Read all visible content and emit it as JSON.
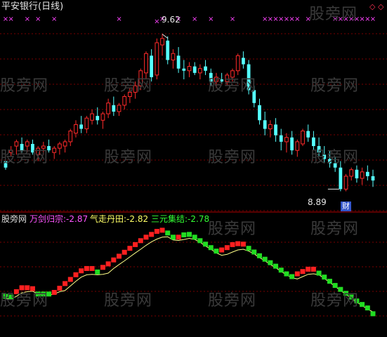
{
  "colors": {
    "background": "#000000",
    "up": "#ff2a2a",
    "down": "#55ffff",
    "grid": "#7a0000",
    "marker": "#ff44ff",
    "red_block": "#ff2020",
    "green_block": "#22dd22",
    "signal_line": "#ffff88",
    "title": "#e6e6e6",
    "indicator_name": "#dddddd",
    "wanjian": "#ff55ff",
    "qizou": "#ffff66",
    "sanyuan": "#33ff33",
    "watermark": "#3a3a3a"
  },
  "main_panel": {
    "title": "平安银行(日线)",
    "high_annotation": "9.62",
    "low_annotation": "8.89",
    "finance_badge": "财",
    "diamond_icons": [
      "diamond-outline-icon",
      "diamond-outline-icon"
    ]
  },
  "indicator_panel": {
    "name": "股旁网",
    "values": [
      {
        "label": "万剑归宗:",
        "value": "-2.87"
      },
      {
        "label": "气走丹田:",
        "value": "-2.82"
      },
      {
        "label": "三元集结:",
        "value": "-2.78"
      }
    ]
  },
  "watermark_text": "股旁网",
  "chart_data": {
    "type": "candlestick",
    "price_range": [
      8.8,
      9.72
    ],
    "candles": [
      [
        9.03,
        9.05,
        8.99,
        9.0
      ],
      [
        9.07,
        9.1,
        9.05,
        9.08
      ],
      [
        9.1,
        9.13,
        9.06,
        9.12
      ],
      [
        9.11,
        9.14,
        9.07,
        9.08
      ],
      [
        9.1,
        9.13,
        9.07,
        9.12
      ],
      [
        9.11,
        9.13,
        9.06,
        9.07
      ],
      [
        9.06,
        9.1,
        9.03,
        9.09
      ],
      [
        9.09,
        9.12,
        9.06,
        9.1
      ],
      [
        9.1,
        9.13,
        9.07,
        9.08
      ],
      [
        9.07,
        9.1,
        9.04,
        9.09
      ],
      [
        9.09,
        9.12,
        9.06,
        9.11
      ],
      [
        9.1,
        9.13,
        9.07,
        9.12
      ],
      [
        9.12,
        9.18,
        9.1,
        9.17
      ],
      [
        9.16,
        9.22,
        9.14,
        9.2
      ],
      [
        9.2,
        9.24,
        9.16,
        9.18
      ],
      [
        9.18,
        9.24,
        9.16,
        9.23
      ],
      [
        9.22,
        9.27,
        9.2,
        9.25
      ],
      [
        9.24,
        9.28,
        9.2,
        9.22
      ],
      [
        9.22,
        9.26,
        9.18,
        9.25
      ],
      [
        9.25,
        9.32,
        9.23,
        9.3
      ],
      [
        9.29,
        9.33,
        9.24,
        9.26
      ],
      [
        9.26,
        9.3,
        9.24,
        9.29
      ],
      [
        9.29,
        9.34,
        9.27,
        9.33
      ],
      [
        9.33,
        9.37,
        9.3,
        9.35
      ],
      [
        9.35,
        9.4,
        9.32,
        9.38
      ],
      [
        9.38,
        9.46,
        9.36,
        9.45
      ],
      [
        9.44,
        9.54,
        9.41,
        9.53
      ],
      [
        9.52,
        9.55,
        9.4,
        9.42
      ],
      [
        9.43,
        9.6,
        9.41,
        9.58
      ],
      [
        9.57,
        9.62,
        9.52,
        9.6
      ],
      [
        9.59,
        9.61,
        9.48,
        9.5
      ],
      [
        9.5,
        9.55,
        9.46,
        9.53
      ],
      [
        9.52,
        9.56,
        9.44,
        9.46
      ],
      [
        9.46,
        9.5,
        9.41,
        9.45
      ],
      [
        9.45,
        9.49,
        9.42,
        9.47
      ],
      [
        9.47,
        9.49,
        9.43,
        9.44
      ],
      [
        9.44,
        9.48,
        9.41,
        9.46
      ],
      [
        9.47,
        9.5,
        9.43,
        9.45
      ],
      [
        9.44,
        9.46,
        9.38,
        9.4
      ],
      [
        9.4,
        9.44,
        9.37,
        9.42
      ],
      [
        9.41,
        9.44,
        9.39,
        9.4
      ],
      [
        9.4,
        9.44,
        9.38,
        9.43
      ],
      [
        9.42,
        9.46,
        9.4,
        9.45
      ],
      [
        9.45,
        9.53,
        9.43,
        9.52
      ],
      [
        9.51,
        9.54,
        9.46,
        9.48
      ],
      [
        9.48,
        9.5,
        9.34,
        9.36
      ],
      [
        9.36,
        9.38,
        9.28,
        9.3
      ],
      [
        9.29,
        9.32,
        9.2,
        9.22
      ],
      [
        9.22,
        9.26,
        9.15,
        9.18
      ],
      [
        9.18,
        9.22,
        9.14,
        9.2
      ],
      [
        9.2,
        9.23,
        9.12,
        9.15
      ],
      [
        9.15,
        9.18,
        9.08,
        9.12
      ],
      [
        9.12,
        9.16,
        9.07,
        9.14
      ],
      [
        9.14,
        9.17,
        9.06,
        9.08
      ],
      [
        9.08,
        9.13,
        9.05,
        9.12
      ],
      [
        9.11,
        9.18,
        9.1,
        9.17
      ],
      [
        9.17,
        9.2,
        9.12,
        9.14
      ],
      [
        9.14,
        9.17,
        9.08,
        9.1
      ],
      [
        9.1,
        9.14,
        9.05,
        9.07
      ],
      [
        9.06,
        9.1,
        9.02,
        9.04
      ],
      [
        9.04,
        9.08,
        9.0,
        9.02
      ],
      [
        9.02,
        9.05,
        8.98,
        9.0
      ],
      [
        9.0,
        9.03,
        8.89,
        8.9
      ],
      [
        8.9,
        8.97,
        8.89,
        8.96
      ],
      [
        8.96,
        9.0,
        8.94,
        8.99
      ],
      [
        8.99,
        9.01,
        8.93,
        8.95
      ],
      [
        8.95,
        9.0,
        8.92,
        8.98
      ],
      [
        8.98,
        9.01,
        8.94,
        8.96
      ],
      [
        8.96,
        8.99,
        8.91,
        8.94
      ]
    ],
    "top_markers": [
      [
        0,
        9.69
      ],
      [
        1,
        9.69
      ],
      [
        4,
        9.69
      ],
      [
        6,
        9.69
      ],
      [
        9,
        9.69
      ],
      [
        21,
        9.69
      ],
      [
        28,
        9.68
      ],
      [
        29,
        9.69
      ],
      [
        32,
        9.69
      ],
      [
        35,
        9.69
      ],
      [
        38,
        9.69
      ],
      [
        42,
        9.69
      ],
      [
        48,
        9.69
      ],
      [
        49,
        9.69
      ],
      [
        50,
        9.69
      ],
      [
        51,
        9.69
      ],
      [
        52,
        9.69
      ],
      [
        53,
        9.69
      ],
      [
        54,
        9.69
      ],
      [
        56,
        9.69
      ],
      [
        61,
        9.69
      ],
      [
        62,
        9.69
      ],
      [
        63,
        9.69
      ],
      [
        64,
        9.69
      ],
      [
        65,
        9.69
      ],
      [
        66,
        9.69
      ],
      [
        67,
        9.69
      ],
      [
        68,
        9.69
      ]
    ],
    "indicator_range": [
      -3.0,
      1.6
    ],
    "blocks": [
      [
        -1.55,
        "G"
      ],
      [
        -1.58,
        "G"
      ],
      [
        -1.35,
        "R"
      ],
      [
        -1.18,
        "R"
      ],
      [
        -1.18,
        "R"
      ],
      [
        -1.22,
        "R"
      ],
      [
        -1.45,
        "G"
      ],
      [
        -1.45,
        "G"
      ],
      [
        -1.45,
        "G"
      ],
      [
        -1.38,
        "R"
      ],
      [
        -1.2,
        "R"
      ],
      [
        -1.0,
        "R"
      ],
      [
        -0.82,
        "R"
      ],
      [
        -0.62,
        "R"
      ],
      [
        -0.45,
        "R"
      ],
      [
        -0.35,
        "R"
      ],
      [
        -0.35,
        "R"
      ],
      [
        -0.5,
        "G"
      ],
      [
        -0.3,
        "R"
      ],
      [
        -0.15,
        "R"
      ],
      [
        0.02,
        "R"
      ],
      [
        0.18,
        "R"
      ],
      [
        0.35,
        "R"
      ],
      [
        0.52,
        "R"
      ],
      [
        0.68,
        "R"
      ],
      [
        0.85,
        "R"
      ],
      [
        1.0,
        "R"
      ],
      [
        1.12,
        "R"
      ],
      [
        1.25,
        "R"
      ],
      [
        1.3,
        "R"
      ],
      [
        1.18,
        "G"
      ],
      [
        1.0,
        "G"
      ],
      [
        1.0,
        "R"
      ],
      [
        1.1,
        "G"
      ],
      [
        1.12,
        "G"
      ],
      [
        1.0,
        "G"
      ],
      [
        0.85,
        "G"
      ],
      [
        0.7,
        "G"
      ],
      [
        0.55,
        "G"
      ],
      [
        0.4,
        "G"
      ],
      [
        0.45,
        "R"
      ],
      [
        0.55,
        "R"
      ],
      [
        0.68,
        "R"
      ],
      [
        0.72,
        "R"
      ],
      [
        0.7,
        "R"
      ],
      [
        0.52,
        "G"
      ],
      [
        0.36,
        "G"
      ],
      [
        0.2,
        "G"
      ],
      [
        0.05,
        "G"
      ],
      [
        -0.1,
        "G"
      ],
      [
        -0.25,
        "G"
      ],
      [
        -0.42,
        "G"
      ],
      [
        -0.58,
        "G"
      ],
      [
        -0.7,
        "G"
      ],
      [
        -0.58,
        "R"
      ],
      [
        -0.48,
        "R"
      ],
      [
        -0.38,
        "R"
      ],
      [
        -0.38,
        "R"
      ],
      [
        -0.55,
        "G"
      ],
      [
        -0.72,
        "G"
      ],
      [
        -0.9,
        "G"
      ],
      [
        -1.08,
        "G"
      ],
      [
        -1.25,
        "G"
      ],
      [
        -1.42,
        "G"
      ],
      [
        -1.58,
        "G"
      ],
      [
        -1.75,
        "G"
      ],
      [
        -1.9,
        "G"
      ],
      [
        -2.05,
        "G"
      ],
      [
        -2.3,
        "G"
      ]
    ],
    "signal_line": [
      -1.65,
      -1.66,
      -1.55,
      -1.4,
      -1.35,
      -1.33,
      -1.45,
      -1.48,
      -1.5,
      -1.45,
      -1.35,
      -1.3,
      -1.1,
      -0.9,
      -0.72,
      -0.62,
      -0.6,
      -0.62,
      -0.6,
      -0.55,
      -0.35,
      -0.18,
      -0.02,
      0.15,
      0.32,
      0.48,
      0.65,
      0.8,
      0.92,
      1.0,
      1.02,
      0.88,
      0.86,
      0.9,
      0.95,
      0.9,
      0.78,
      0.62,
      0.48,
      0.32,
      0.22,
      0.26,
      0.36,
      0.45,
      0.48,
      0.4,
      0.28,
      0.12,
      -0.02,
      -0.18,
      -0.32,
      -0.48,
      -0.62,
      -0.75,
      -0.8,
      -0.7,
      -0.6,
      -0.58,
      -0.62,
      -0.78,
      -0.95,
      -1.12,
      -1.3,
      -1.46,
      -1.64,
      -1.8,
      -1.95,
      -2.1,
      -2.22
    ]
  }
}
